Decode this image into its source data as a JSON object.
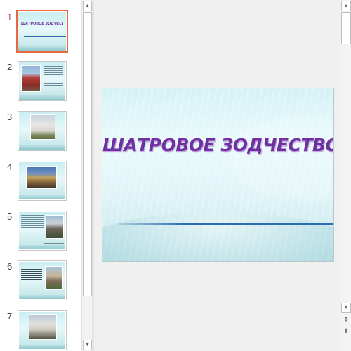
{
  "thumbnails": [
    {
      "number": "1",
      "title": "ШАТРОВОЕ ЗОДЧЕСТВО",
      "selected": true
    },
    {
      "number": "2",
      "selected": false
    },
    {
      "number": "3",
      "selected": false
    },
    {
      "number": "4",
      "selected": false
    },
    {
      "number": "5",
      "selected": false
    },
    {
      "number": "6",
      "selected": false
    },
    {
      "number": "7",
      "selected": false
    }
  ],
  "slide": {
    "title": "ШАТРОВОЕ ЗОДЧЕСТВО"
  },
  "icons": {
    "scroll_up": "▲",
    "scroll_down": "▼",
    "prev_slide": "⇞",
    "next_slide": "⇟"
  },
  "colors": {
    "selected_border": "#e8683d",
    "title_purple": "#7030a0",
    "accent_line": "#2a6db5"
  }
}
